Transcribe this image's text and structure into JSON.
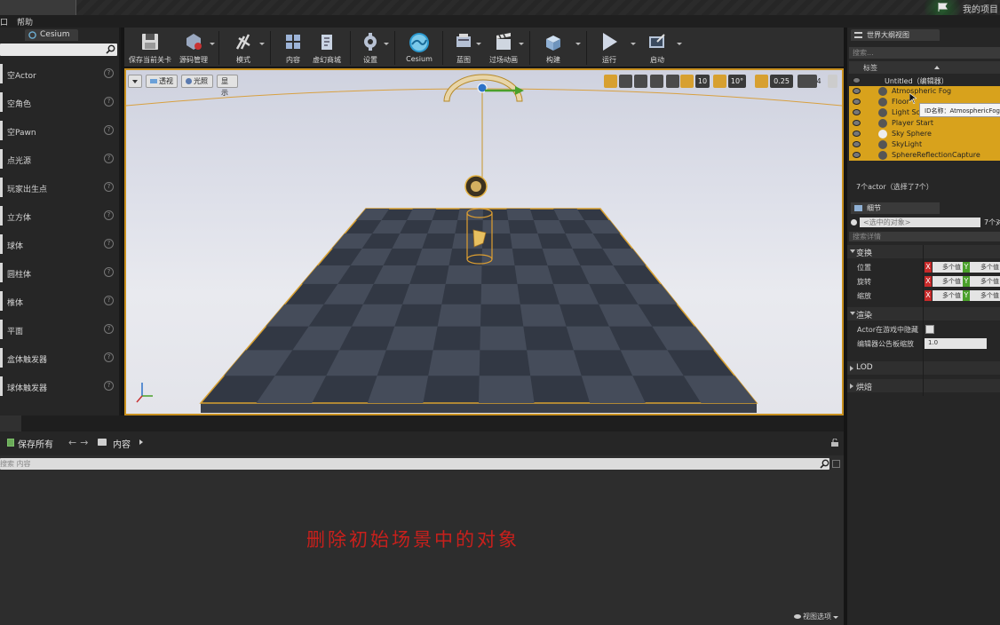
{
  "window": {
    "project_name": "我的项目"
  },
  "menu": {
    "items": [
      "口",
      "帮助"
    ]
  },
  "place_panel": {
    "tab_label": "Cesium",
    "items": [
      "空Actor",
      "空角色",
      "空Pawn",
      "点光源",
      "玩家出生点",
      "立方体",
      "球体",
      "圆柱体",
      "椎体",
      "平面",
      "盒体触发器",
      "球体触发器"
    ]
  },
  "toolbar": {
    "buttons": [
      {
        "label": "保存当前关卡",
        "icon": "save-icon"
      },
      {
        "label": "源码管理",
        "icon": "source-control-icon"
      },
      {
        "label": "模式",
        "icon": "modes-icon"
      },
      {
        "label": "内容",
        "icon": "content-icon"
      },
      {
        "label": "虚幻商城",
        "icon": "marketplace-icon"
      },
      {
        "label": "设置",
        "icon": "settings-icon"
      },
      {
        "label": "Cesium",
        "icon": "cesium-icon"
      },
      {
        "label": "蓝图",
        "icon": "blueprint-icon"
      },
      {
        "label": "过场动画",
        "icon": "cinematics-icon"
      },
      {
        "label": "构建",
        "icon": "build-icon"
      },
      {
        "label": "运行",
        "icon": "play-icon"
      },
      {
        "label": "启动",
        "icon": "launch-icon"
      }
    ]
  },
  "viewport": {
    "perspective_label": "透视",
    "lit_label": "光照",
    "show_label": "显示",
    "grid_snap": "10",
    "rotation_snap": "10°",
    "scale_snap": "0.25",
    "camera_speed": "4",
    "accent": "#d7a030"
  },
  "content_browser": {
    "save_all": "保存所有",
    "path": "内容",
    "search_placeholder": "搜索 内容",
    "view_options": "视图选项"
  },
  "caption": "删除初始场景中的对象",
  "outliner": {
    "tab_label": "世界大纲视图",
    "search_placeholder": "搜索...",
    "column_label": "标签",
    "root": "Untitled（编辑器）",
    "items": [
      "Atmospheric Fog",
      "Floor",
      "Light Source",
      "Player Start",
      "Sky Sphere",
      "SkyLight",
      "SphereReflectionCapture"
    ],
    "tooltip": "ID名称：AtmosphericFog_",
    "count": "7个actor（选择了7个）"
  },
  "details": {
    "tab_label": "细节",
    "selected_placeholder": "<选中的对象>",
    "selected_count": "7个对",
    "search_placeholder": "搜索详情",
    "transform_label": "变换",
    "location_label": "位置",
    "rotation_label": "旋转",
    "scale_label": "缩放",
    "multiple_values": "多个值",
    "rendering_label": "渲染",
    "hidden_in_game_label": "Actor在游戏中隐藏",
    "billboard_scale_label": "编辑器公告板缩放",
    "billboard_scale_value": "1.0",
    "lod_label": "LOD",
    "baking_label": "烘焙"
  }
}
